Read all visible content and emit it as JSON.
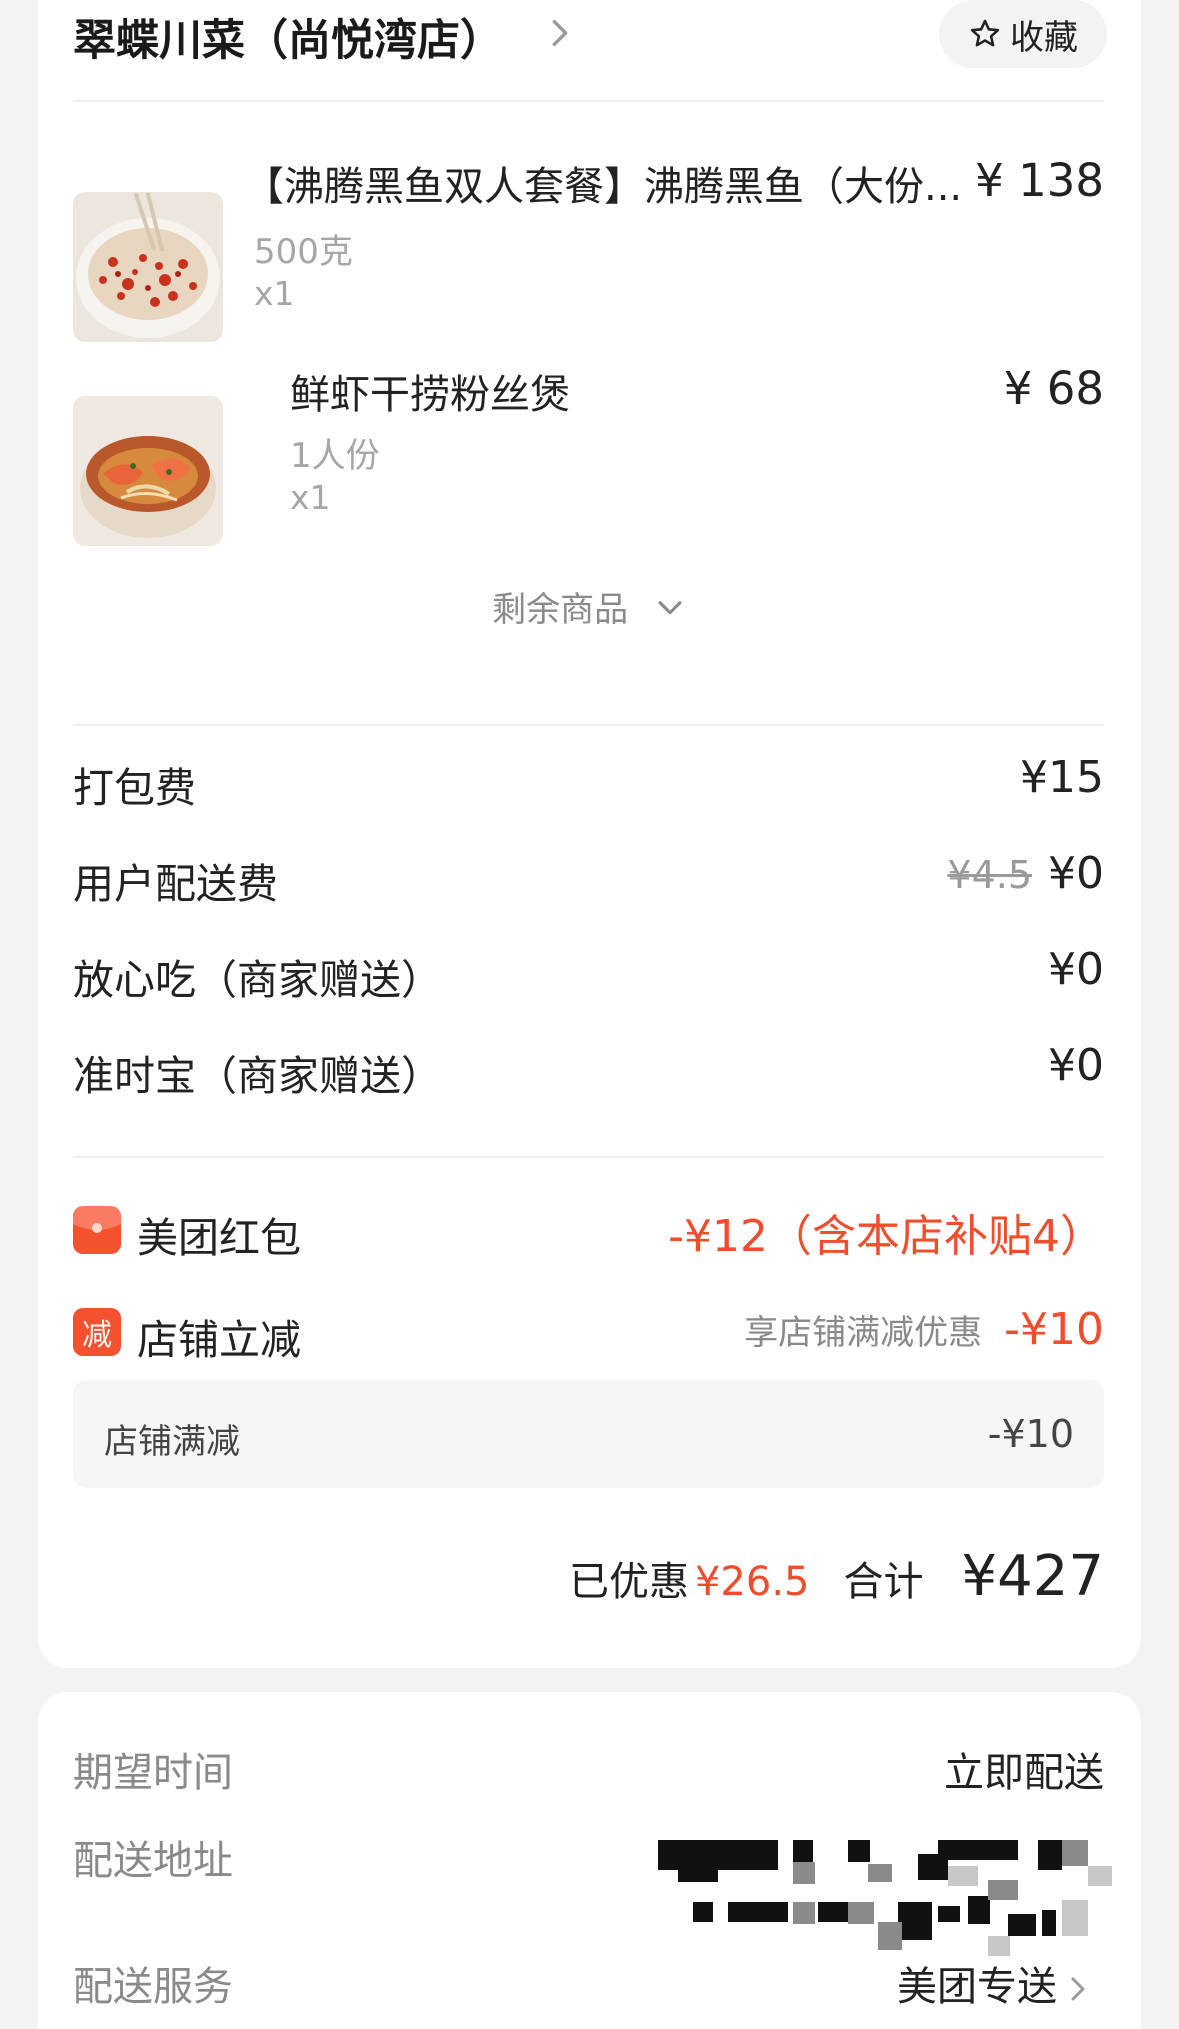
{
  "shop": {
    "name": "翠蝶川菜（尚悦湾店）",
    "favorite_label": "收藏"
  },
  "items": [
    {
      "name": "【沸腾黑鱼双人套餐】沸腾黑鱼（大份...",
      "spec": "500克",
      "qty": "x1",
      "price": "¥ 138",
      "image": "spicy-fish-dish"
    },
    {
      "name": "鲜虾干捞粉丝煲",
      "spec": "1人份",
      "qty": "x1",
      "price": "¥ 68",
      "image": "shrimp-vermicelli-pot"
    }
  ],
  "more_goods_label": "剩余商品",
  "fees": [
    {
      "label": "打包费",
      "value": "¥15"
    },
    {
      "label": "用户配送费",
      "original": "¥4.5",
      "value": "¥0"
    },
    {
      "label": "放心吃（商家赠送）",
      "value": "¥0"
    },
    {
      "label": "准时宝（商家赠送）",
      "value": "¥0"
    }
  ],
  "promotions": [
    {
      "icon": "red-packet-icon",
      "icon_text": "",
      "label": "美团红包",
      "value": "-¥12（含本店补贴4）"
    },
    {
      "icon": "discount-icon",
      "icon_text": "减",
      "label": "店铺立减",
      "hint": "享店铺满减优惠",
      "value": "-¥10"
    }
  ],
  "sub_discount": {
    "label": "店铺满减",
    "value": "-¥10"
  },
  "summary": {
    "saved_label": "已优惠",
    "saved_value": "¥26.5",
    "total_label": "合计",
    "total_value": "¥427"
  },
  "delivery": {
    "time_label": "期望时间",
    "time_value": "立即配送",
    "address_label": "配送地址",
    "service_label": "配送服务",
    "service_value": "美团专送"
  },
  "colors": {
    "accent": "#f04d2d",
    "icon_bg": "#f4512f",
    "page_bg": "#f3f3f3",
    "muted_text": "#a6a6a6"
  }
}
